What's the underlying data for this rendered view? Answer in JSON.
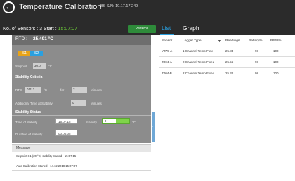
{
  "header": {
    "title": "Temperature Calibration",
    "serial": "BS S/N: 10.17.17.249",
    "sensors_label": "No. of Sensors : 3",
    "start_label": "Start :",
    "start_time": "15:07:07",
    "pattern_button": "Patterns",
    "tabs": [
      {
        "label": "List"
      },
      {
        "label": "Graph"
      }
    ]
  },
  "left_panel": {
    "rtd_label": "RTD :",
    "rtd_value": "25.491 °C",
    "setpoints": [
      {
        "label": "S1",
        "color": "#e8a317"
      },
      {
        "label": "S2",
        "color": "#2aa0e0"
      }
    ],
    "setpoint_label": "Setpoint",
    "setpoint_value": "30.0",
    "setpoint_unit": "°C",
    "stability_criteria_title": "Stability Criteria",
    "rtd_crit_label": "RTD",
    "rtd_crit_value": "0.012",
    "rtd_crit_unit": "°C",
    "for_label": "for",
    "for_value": "2",
    "minutes_label": "Minutes",
    "additional_label": "Additional Time at Stability",
    "additional_value": "0",
    "minutes_label2": "Minutes",
    "stability_status_title": "Stability Status",
    "time_of_stability_label": "Time of stability",
    "time_of_stability_value": "15:07:15",
    "stability_label": "Stability",
    "stability_value": "0",
    "stability_unit": "°C",
    "duration_label": "Duration of stability",
    "duration_value": "00:00:05"
  },
  "messages": {
    "header": "Message",
    "items": [
      "Setpoint S1 (20 °C) stability started - 15:07:15",
      "Auto Calibration Started - 14.12.2018 15:07:07"
    ]
  },
  "table": {
    "columns": [
      "Sensor",
      "Logger Type",
      "Readings",
      "Battery%",
      "RSSI%"
    ],
    "rows": [
      [
        "YZ75-A",
        "1 Channel Temp-Flex",
        "25.83",
        "98",
        "100"
      ],
      [
        "Z004-A",
        "2 Channel Temp-Fixed",
        "25.56",
        "98",
        "100"
      ],
      [
        "Z004-B",
        "2 Channel Temp-Fixed",
        "25.32",
        "98",
        "100"
      ]
    ]
  },
  "icons": {
    "back": "back-arrow-icon",
    "filter": "filter-icon"
  }
}
